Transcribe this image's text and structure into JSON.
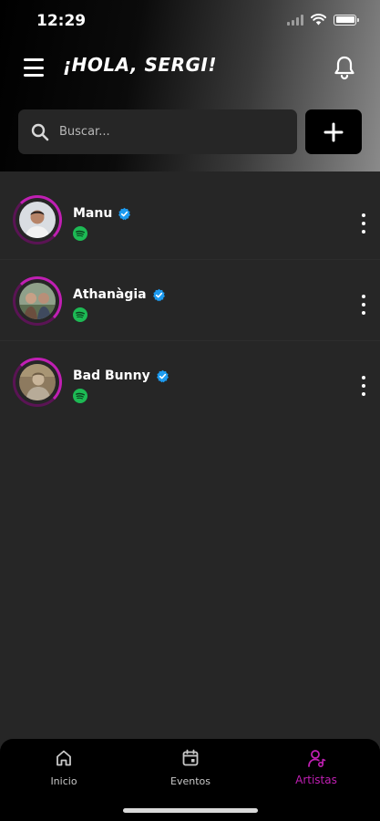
{
  "status_bar": {
    "time": "12:29"
  },
  "header": {
    "greeting": "¡HOLA, SERGI!"
  },
  "search": {
    "placeholder": "Buscar..."
  },
  "colors": {
    "accent": "#c01fb3",
    "verified": "#1d9bf0",
    "spotify": "#1db954"
  },
  "artists": [
    {
      "name": "Manu",
      "verified": true,
      "icon": "spotify-icon"
    },
    {
      "name": "Athanàgia",
      "verified": true,
      "icon": "spotify-icon"
    },
    {
      "name": "Bad Bunny",
      "verified": true,
      "icon": "spotify-icon"
    }
  ],
  "nav": {
    "items": [
      {
        "label": "Inicio",
        "icon": "home-icon",
        "active": false
      },
      {
        "label": "Eventos",
        "icon": "calendar-icon",
        "active": false
      },
      {
        "label": "Artistas",
        "icon": "artist-icon",
        "active": true
      }
    ]
  }
}
